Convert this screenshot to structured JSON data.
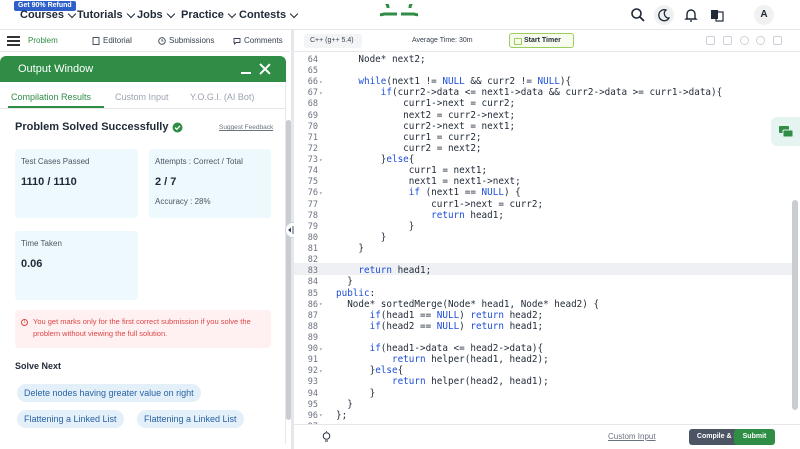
{
  "nav": {
    "promo": "Get 90% Refund",
    "items": [
      "Courses",
      "Tutorials",
      "Jobs",
      "Practice",
      "Contests"
    ],
    "avatar": "A",
    "brand_color": "#2f8d46"
  },
  "left_tabs": [
    "Problem",
    "Editorial",
    "Submissions",
    "Comments"
  ],
  "output": {
    "title": "Output Window",
    "tabs": [
      "Compilation Results",
      "Custom Input",
      "Y.O.G.I. (AI Bot)"
    ],
    "status": "Problem Solved Successfully",
    "suggest": "Suggest Feedback",
    "cards": {
      "test_label": "Test Cases Passed",
      "test_value": "1110 / 1110",
      "attempts_label": "Attempts : Correct / Total",
      "attempts_value": "2 / 7",
      "accuracy": "Accuracy : 28%",
      "time_label": "Time Taken",
      "time_value": "0.06"
    },
    "note": "You get marks only for the first correct submission if you solve the problem without viewing the full solution.",
    "solve_next": "Solve Next",
    "chips": [
      "Delete nodes having greater value on right",
      "Flattening a Linked List",
      "Flattening a Linked List"
    ]
  },
  "editor": {
    "language": "C++ (g++ 5.4)",
    "avg_time": "Average Time: 30m",
    "timer": "Start Timer",
    "custom_input": "Custom Input",
    "run": "Compile & Run",
    "submit": "Submit",
    "lines": [
      {
        "n": "64",
        "f": "",
        "code": "    Node* next2;"
      },
      {
        "n": "65",
        "f": "",
        "code": ""
      },
      {
        "n": "66",
        "f": "▾",
        "code": "    while(next1 != NULL && curr2 != NULL){"
      },
      {
        "n": "67",
        "f": "▾",
        "code": "        if(curr2->data <= next1->data && curr2->data >= curr1->data){"
      },
      {
        "n": "68",
        "f": "",
        "code": "            curr1->next = curr2;"
      },
      {
        "n": "69",
        "f": "",
        "code": "            next2 = curr2->next;"
      },
      {
        "n": "70",
        "f": "",
        "code": "            curr2->next = next1;"
      },
      {
        "n": "71",
        "f": "",
        "code": "            curr1 = curr2;"
      },
      {
        "n": "72",
        "f": "",
        "code": "            curr2 = next2;"
      },
      {
        "n": "73",
        "f": "▾",
        "code": "        }else{"
      },
      {
        "n": "74",
        "f": "",
        "code": "             curr1 = next1;"
      },
      {
        "n": "75",
        "f": "",
        "code": "             next1 = next1->next;"
      },
      {
        "n": "76",
        "f": "▾",
        "code": "             if (next1 == NULL) {"
      },
      {
        "n": "77",
        "f": "",
        "code": "                 curr1->next = curr2;"
      },
      {
        "n": "78",
        "f": "",
        "code": "                 return head1;"
      },
      {
        "n": "79",
        "f": "",
        "code": "             }"
      },
      {
        "n": "80",
        "f": "",
        "code": "        }"
      },
      {
        "n": "81",
        "f": "",
        "code": "    }"
      },
      {
        "n": "82",
        "f": "",
        "code": ""
      },
      {
        "n": "83",
        "f": "",
        "code": "    return head1;"
      },
      {
        "n": "84",
        "f": "",
        "code": "  }"
      },
      {
        "n": "85",
        "f": "",
        "code": "public:"
      },
      {
        "n": "86",
        "f": "▾",
        "code": "  Node* sortedMerge(Node* head1, Node* head2) {"
      },
      {
        "n": "87",
        "f": "",
        "code": "      if(head1 == NULL) return head2;"
      },
      {
        "n": "88",
        "f": "",
        "code": "      if(head2 == NULL) return head1;"
      },
      {
        "n": "89",
        "f": "",
        "code": ""
      },
      {
        "n": "90",
        "f": "▾",
        "code": "      if(head1->data <= head2->data){"
      },
      {
        "n": "91",
        "f": "",
        "code": "          return helper(head1, head2);"
      },
      {
        "n": "92",
        "f": "▾",
        "code": "      }else{"
      },
      {
        "n": "93",
        "f": "",
        "code": "          return helper(head2, head1);"
      },
      {
        "n": "94",
        "f": "",
        "code": "      }"
      },
      {
        "n": "95",
        "f": "",
        "code": "  }"
      },
      {
        "n": "96",
        "f": "▾",
        "code": "};"
      },
      {
        "n": "97",
        "f": "",
        "code": ""
      }
    ]
  }
}
